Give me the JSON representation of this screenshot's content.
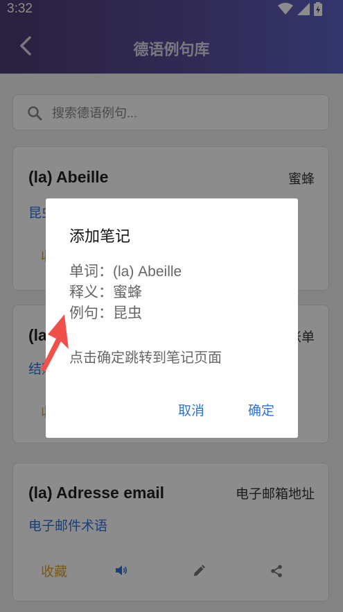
{
  "status": {
    "time": "3:32"
  },
  "header": {
    "title": "德语例句库"
  },
  "search": {
    "placeholder": "搜索德语例句..."
  },
  "cards": [
    {
      "word": "(la) Abeille",
      "meaning": "蜜蜂",
      "category": "昆虫",
      "fav": "收藏"
    },
    {
      "word": "(la) Addition",
      "meaning": "账单",
      "category": "结账",
      "fav": "收藏"
    },
    {
      "word": "(la) Adresse email",
      "meaning": "电子邮箱地址",
      "category": "电子邮件术语",
      "fav": "收藏"
    }
  ],
  "dialog": {
    "title": "添加笔记",
    "word_line": "单词：(la) Abeille",
    "meaning_line": "释义：蜜蜂",
    "example_line": "例句：昆虫",
    "hint": "点击确定跳转到笔记页面",
    "cancel": "取消",
    "confirm": "确定"
  },
  "colors": {
    "accent": "#2f72d6",
    "favorite": "#e2a21a",
    "header_start": "#4d3b73",
    "header_end": "#5d62c4"
  }
}
